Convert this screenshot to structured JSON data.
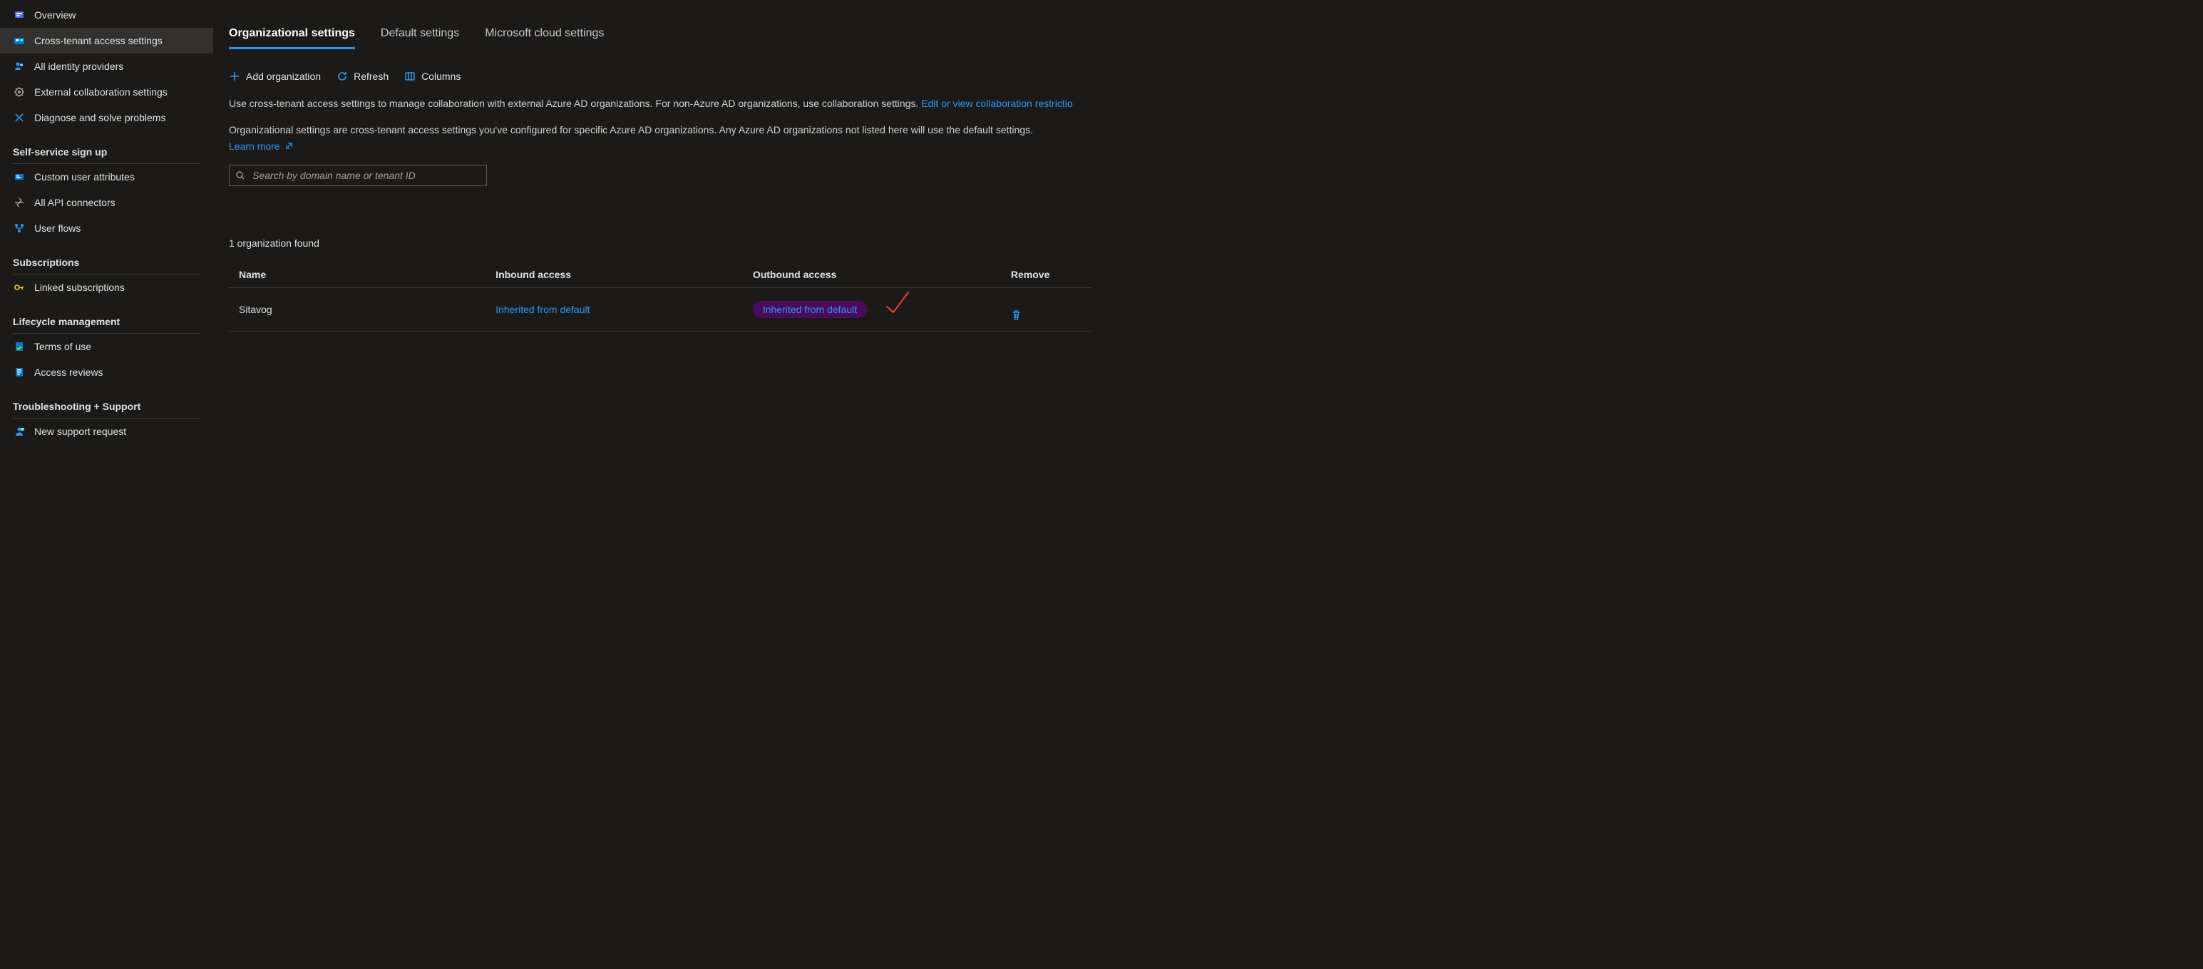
{
  "sidebar": {
    "items_top": [
      {
        "label": "Overview",
        "icon": "overview-icon"
      },
      {
        "label": "Cross-tenant access settings",
        "icon": "cross-tenant-icon",
        "active": true
      },
      {
        "label": "All identity providers",
        "icon": "people-icon"
      },
      {
        "label": "External collaboration settings",
        "icon": "gear-icon"
      },
      {
        "label": "Diagnose and solve problems",
        "icon": "diagnose-icon"
      }
    ],
    "sections": [
      {
        "title": "Self-service sign up",
        "items": [
          {
            "label": "Custom user attributes",
            "icon": "attributes-icon"
          },
          {
            "label": "All API connectors",
            "icon": "api-icon"
          },
          {
            "label": "User flows",
            "icon": "flows-icon"
          }
        ]
      },
      {
        "title": "Subscriptions",
        "items": [
          {
            "label": "Linked subscriptions",
            "icon": "key-icon"
          }
        ]
      },
      {
        "title": "Lifecycle management",
        "items": [
          {
            "label": "Terms of use",
            "icon": "terms-icon"
          },
          {
            "label": "Access reviews",
            "icon": "reviews-icon"
          }
        ]
      },
      {
        "title": "Troubleshooting + Support",
        "items": [
          {
            "label": "New support request",
            "icon": "support-icon"
          }
        ]
      }
    ]
  },
  "tabs": [
    {
      "label": "Organizational settings",
      "active": true
    },
    {
      "label": "Default settings"
    },
    {
      "label": "Microsoft cloud settings"
    }
  ],
  "toolbar": {
    "add": "Add organization",
    "refresh": "Refresh",
    "columns": "Columns"
  },
  "descriptions": {
    "line1": "Use cross-tenant access settings to manage collaboration with external Azure AD organizations. For non-Azure AD organizations, use collaboration settings. ",
    "line1_link": "Edit or view collaboration restrictio",
    "line2": "Organizational settings are cross-tenant access settings you've configured for specific Azure AD organizations. Any Azure AD organizations not listed here will use the default settings.",
    "learn_more": "Learn more"
  },
  "search": {
    "placeholder": "Search by domain name or tenant ID"
  },
  "count_text": "1 organization found",
  "table": {
    "headers": {
      "name": "Name",
      "inbound": "Inbound access",
      "outbound": "Outbound access",
      "remove": "Remove"
    },
    "rows": [
      {
        "name": "Sitavog",
        "inbound": "Inherited from default",
        "outbound": "Inherited from default"
      }
    ]
  }
}
